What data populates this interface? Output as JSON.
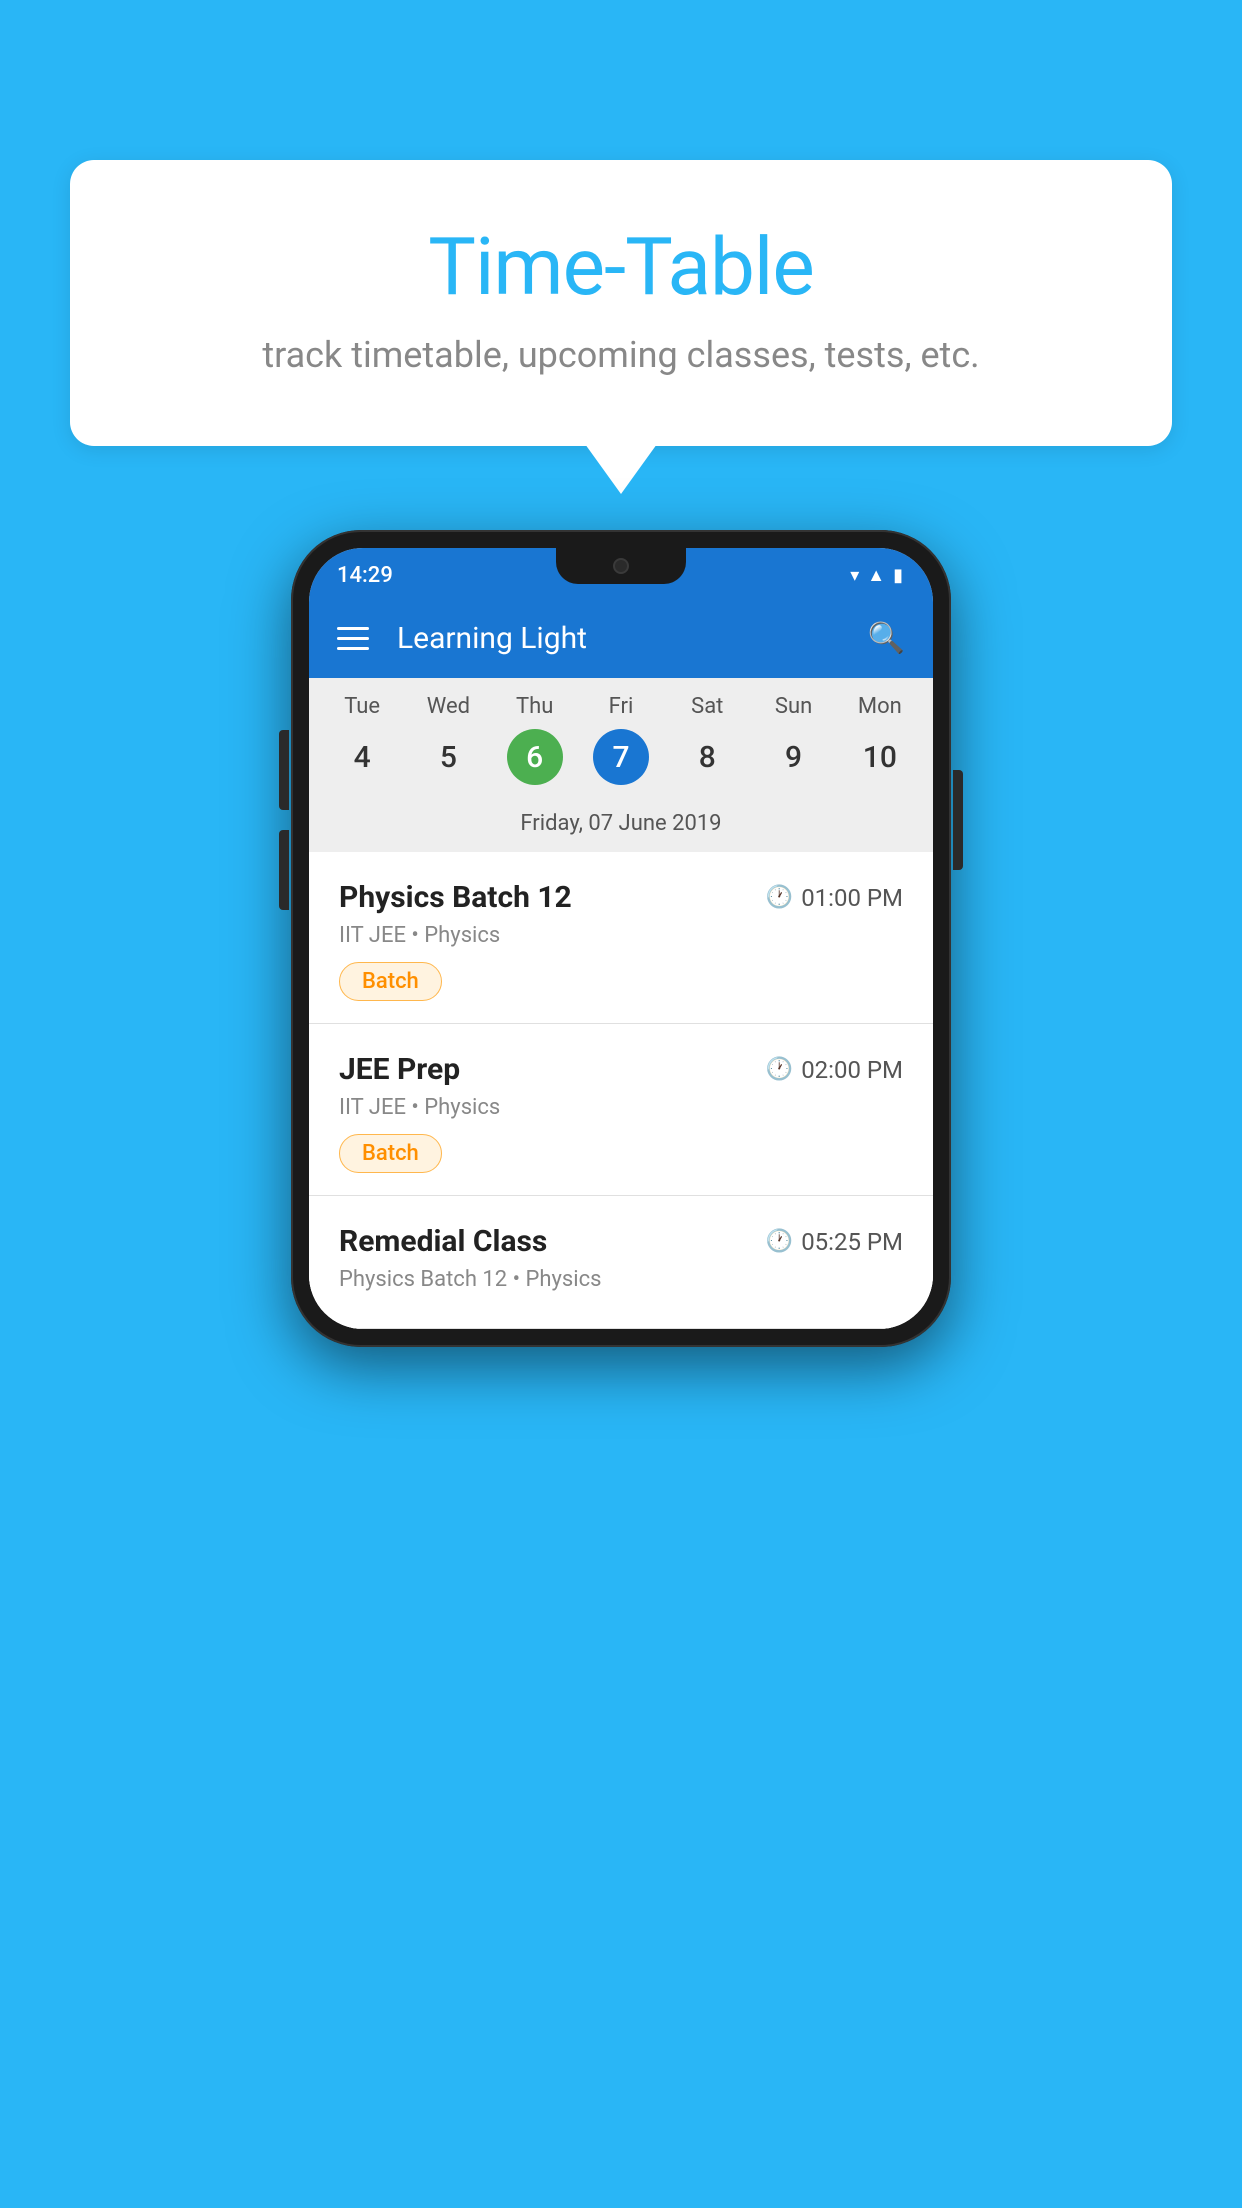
{
  "page": {
    "background_color": "#29B6F6"
  },
  "bubble": {
    "title": "Time-Table",
    "subtitle": "track timetable, upcoming classes, tests, etc."
  },
  "phone": {
    "status_bar": {
      "time": "14:29"
    },
    "app_bar": {
      "title": "Learning Light"
    },
    "calendar": {
      "weekdays": [
        "Tue",
        "Wed",
        "Thu",
        "Fri",
        "Sat",
        "Sun",
        "Mon"
      ],
      "dates": [
        {
          "num": "4",
          "state": "normal"
        },
        {
          "num": "5",
          "state": "normal"
        },
        {
          "num": "6",
          "state": "today"
        },
        {
          "num": "7",
          "state": "selected"
        },
        {
          "num": "8",
          "state": "normal"
        },
        {
          "num": "9",
          "state": "normal"
        },
        {
          "num": "10",
          "state": "normal"
        }
      ],
      "selected_date_label": "Friday, 07 June 2019"
    },
    "schedule": {
      "items": [
        {
          "title": "Physics Batch 12",
          "time": "01:00 PM",
          "meta": "IIT JEE • Physics",
          "badge": "Batch"
        },
        {
          "title": "JEE Prep",
          "time": "02:00 PM",
          "meta": "IIT JEE • Physics",
          "badge": "Batch"
        },
        {
          "title": "Remedial Class",
          "time": "05:25 PM",
          "meta": "Physics Batch 12 • Physics",
          "badge": null
        }
      ]
    }
  }
}
